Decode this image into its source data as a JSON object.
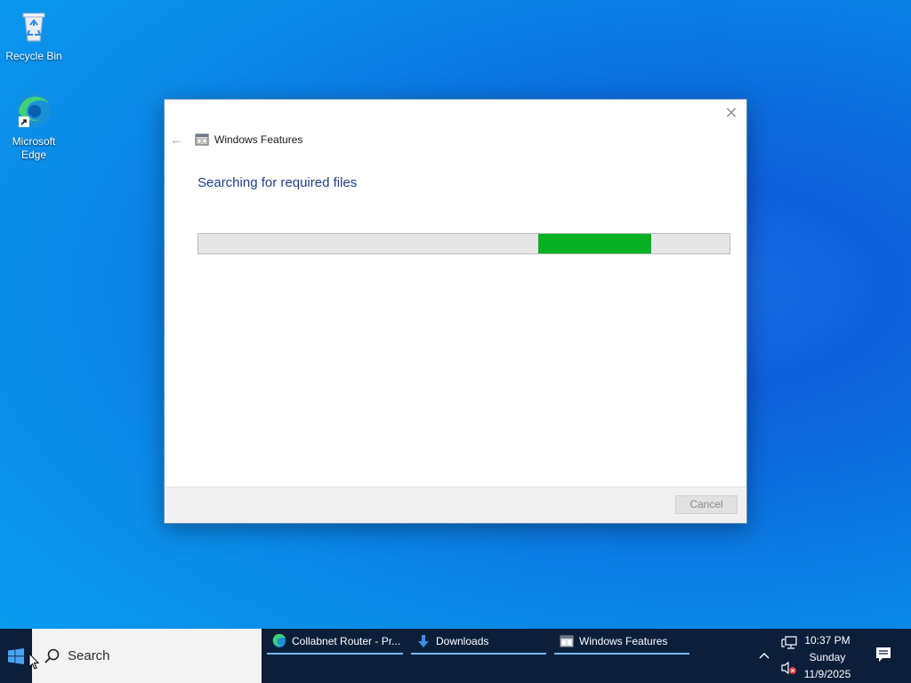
{
  "desktop": {
    "icons": [
      {
        "label": "Recycle Bin",
        "icon": "recycle-bin-icon"
      },
      {
        "label": "Microsoft Edge",
        "icon": "edge-icon"
      }
    ]
  },
  "dialog": {
    "title": "Windows Features",
    "heading": "Searching for required files",
    "progress_state": "indeterminate",
    "cancel_label": "Cancel",
    "icons": {
      "back": "back-arrow-icon",
      "app": "windows-features-icon",
      "close": "close-icon"
    }
  },
  "taskbar": {
    "search_label": "Search",
    "buttons": [
      {
        "label": "Collabnet Router - Pr...",
        "icon": "edge-icon"
      },
      {
        "label": "Downloads",
        "icon": "download-arrow-icon"
      },
      {
        "label": "Windows Features",
        "icon": "windows-features-icon"
      }
    ],
    "clock": {
      "time": "10:37 PM",
      "day": "Sunday",
      "date": "11/9/2025"
    },
    "colors": {
      "taskbar_bg": "#0b1f3b",
      "accent_underline": "#76b9ed",
      "progress_fill": "#06b025"
    }
  }
}
